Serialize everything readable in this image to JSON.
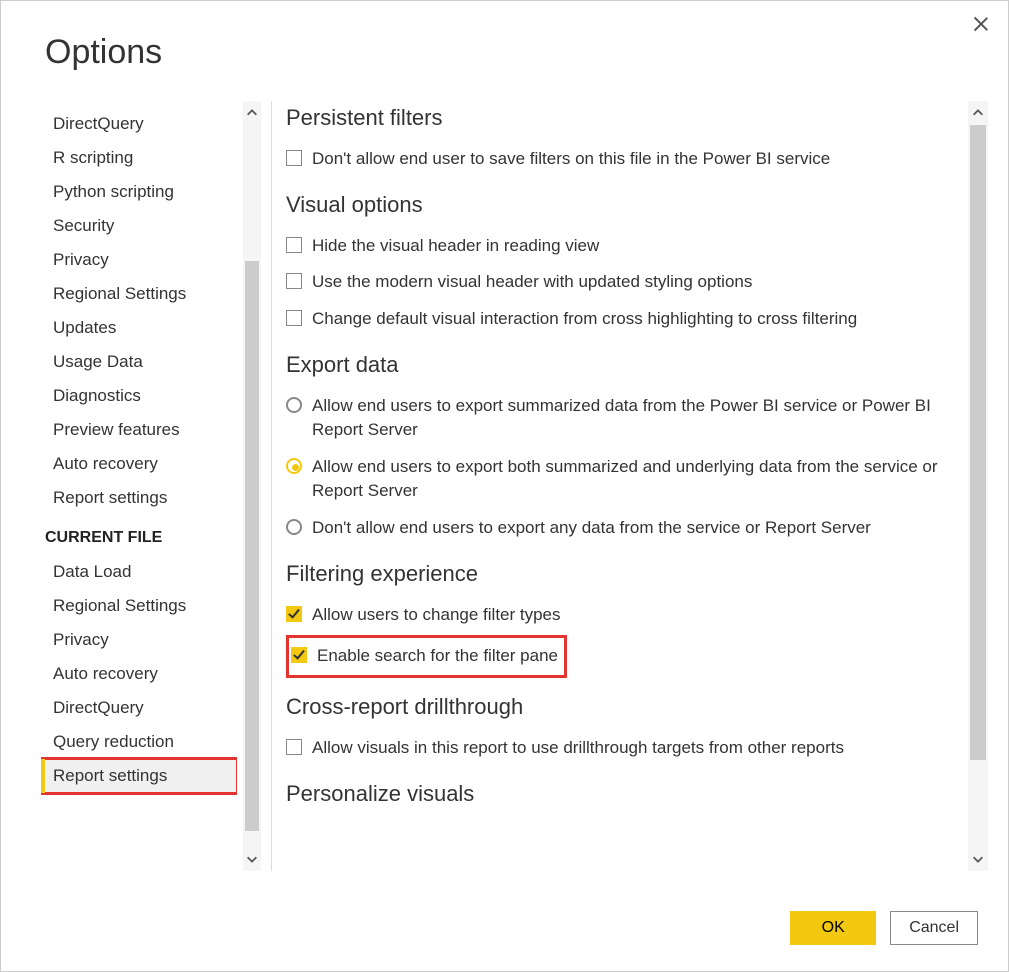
{
  "window": {
    "title": "Options"
  },
  "sidebar": {
    "global_items": [
      "DirectQuery",
      "R scripting",
      "Python scripting",
      "Security",
      "Privacy",
      "Regional Settings",
      "Updates",
      "Usage Data",
      "Diagnostics",
      "Preview features",
      "Auto recovery",
      "Report settings"
    ],
    "current_header": "CURRENT FILE",
    "current_items": [
      "Data Load",
      "Regional Settings",
      "Privacy",
      "Auto recovery",
      "DirectQuery",
      "Query reduction",
      "Report settings"
    ],
    "selected": "Report settings"
  },
  "sections": {
    "persistent": {
      "title": "Persistent filters",
      "cb1": "Don't allow end user to save filters on this file in the Power BI service"
    },
    "visual": {
      "title": "Visual options",
      "cb1": "Hide the visual header in reading view",
      "cb2": "Use the modern visual header with updated styling options",
      "cb3": "Change default visual interaction from cross highlighting to cross filtering"
    },
    "export": {
      "title": "Export data",
      "r1": "Allow end users to export summarized data from the Power BI service or Power BI Report Server",
      "r2": "Allow end users to export both summarized and underlying data from the service or Report Server",
      "r3": "Don't allow end users to export any data from the service or Report Server"
    },
    "filtering": {
      "title": "Filtering experience",
      "cb1": "Allow users to change filter types",
      "cb2": "Enable search for the filter pane"
    },
    "cross": {
      "title": "Cross-report drillthrough",
      "cb1": "Allow visuals in this report to use drillthrough targets from other reports"
    },
    "personalize": {
      "title": "Personalize visuals"
    }
  },
  "footer": {
    "ok": "OK",
    "cancel": "Cancel"
  }
}
